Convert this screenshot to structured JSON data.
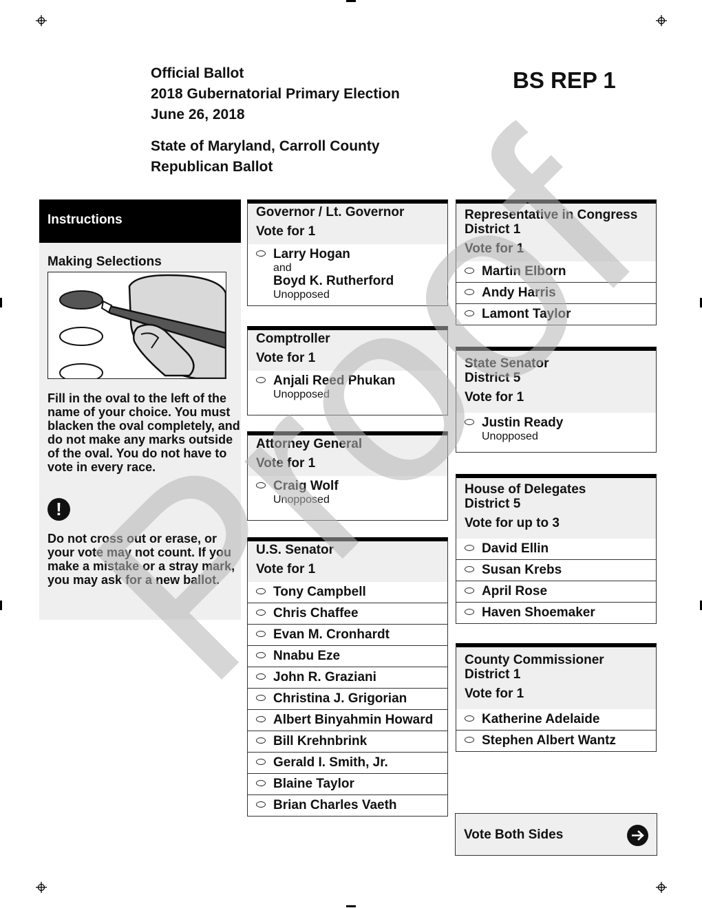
{
  "header": {
    "lines": [
      "Official Ballot",
      "2018 Gubernatorial Primary Election",
      "June 26, 2018"
    ],
    "jurisdiction": [
      "State of Maryland, Carroll County",
      "Republican Ballot"
    ],
    "ballot_code": "BS REP 1"
  },
  "instructions": {
    "title": "Instructions",
    "subtitle": "Making Selections",
    "text1": "Fill in the oval to the left of the name of your choice. You must blacken the oval completely, and do not make any marks outside of the oval. You do not have to vote in every race.",
    "warning_icon": "exclamation-icon",
    "warning_symbol": "!",
    "text2": "Do not cross out or erase, or your vote may not count. If you make a mistake or a stray mark, you may ask for a new ballot."
  },
  "contests": [
    {
      "title": "Governor / Lt. Governor",
      "vote": "Vote for 1",
      "candidates": [
        {
          "name": "Larry Hogan",
          "joiner": "and",
          "running_mate": "Boyd K. Rutherford",
          "note": "Unopposed"
        }
      ]
    },
    {
      "title": "Comptroller",
      "vote": "Vote for 1",
      "candidates": [
        {
          "name": "Anjali Reed Phukan",
          "note": "Unopposed"
        }
      ]
    },
    {
      "title": "Attorney General",
      "vote": "Vote for 1",
      "candidates": [
        {
          "name": "Craig Wolf",
          "note": "Unopposed"
        }
      ]
    },
    {
      "title": "U.S. Senator",
      "vote": "Vote for 1",
      "candidates": [
        {
          "name": "Tony Campbell"
        },
        {
          "name": "Chris Chaffee"
        },
        {
          "name": "Evan M. Cronhardt"
        },
        {
          "name": "Nnabu Eze"
        },
        {
          "name": "John R. Graziani"
        },
        {
          "name": "Christina J. Grigorian"
        },
        {
          "name": "Albert Binyahmin Howard"
        },
        {
          "name": "Bill Krehnbrink"
        },
        {
          "name": "Gerald I. Smith, Jr."
        },
        {
          "name": "Blaine Taylor"
        },
        {
          "name": "Brian Charles Vaeth"
        }
      ]
    },
    {
      "title": "Representative in Congress",
      "district": "District 1",
      "vote": "Vote for 1",
      "candidates": [
        {
          "name": "Martin Elborn"
        },
        {
          "name": "Andy Harris"
        },
        {
          "name": "Lamont Taylor"
        }
      ]
    },
    {
      "title": "State Senator",
      "district": "District 5",
      "vote": "Vote for 1",
      "candidates": [
        {
          "name": "Justin Ready",
          "note": "Unopposed"
        }
      ]
    },
    {
      "title": "House of Delegates",
      "district": "District 5",
      "vote": "Vote for up to 3",
      "candidates": [
        {
          "name": "David Ellin"
        },
        {
          "name": "Susan Krebs"
        },
        {
          "name": "April Rose"
        },
        {
          "name": "Haven Shoemaker"
        }
      ]
    },
    {
      "title": "County Commissioner",
      "district": "District 1",
      "vote": "Vote for 1",
      "candidates": [
        {
          "name": "Katherine Adelaide"
        },
        {
          "name": "Stephen Albert Wantz"
        }
      ]
    }
  ],
  "footer": {
    "vote_both_sides": "Vote Both Sides",
    "arrow_icon": "arrow-right-icon"
  },
  "watermark": "Proof"
}
